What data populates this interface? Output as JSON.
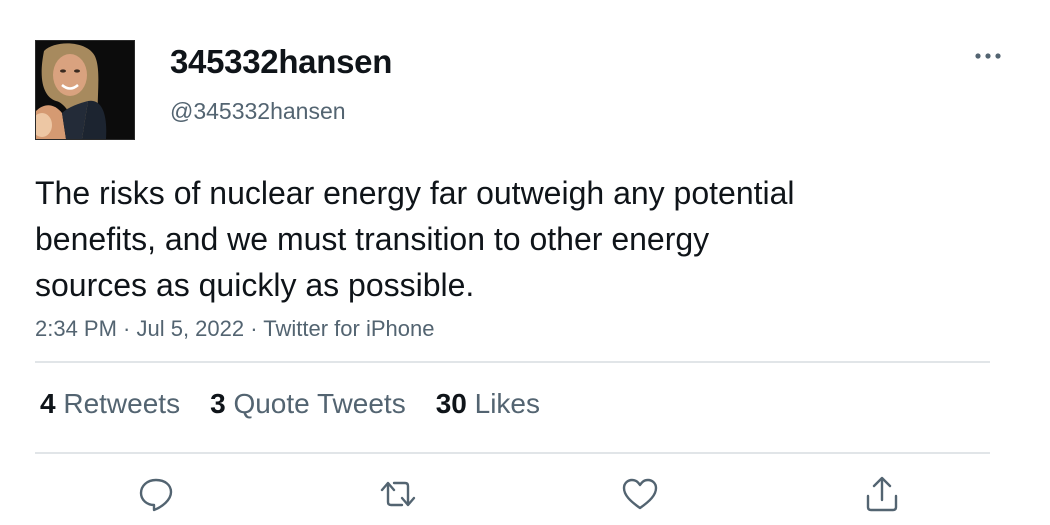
{
  "user": {
    "display_name": "345332hansen",
    "handle": "@345332hansen",
    "avatar_icon": "profile-photo"
  },
  "tweet": {
    "text_lines": [
      "The risks of nuclear energy far outweigh any potential",
      "benefits, and we must transition to other energy",
      "sources as quickly as possible."
    ],
    "meta": "2:34 PM · Jul 5, 2022 · Twitter for iPhone"
  },
  "stats": {
    "retweets": {
      "count": "4",
      "label": "Retweets"
    },
    "quotes": {
      "count": "3",
      "label": "Quote Tweets"
    },
    "likes": {
      "count": "30",
      "label": "Likes"
    }
  },
  "icons": {
    "more": "more-icon",
    "reply": "reply-icon",
    "retweet": "retweet-icon",
    "like": "heart-icon",
    "share": "share-icon"
  },
  "colors": {
    "text": "#0f1419",
    "secondary": "#536471",
    "divider": "#e1e5e8"
  }
}
